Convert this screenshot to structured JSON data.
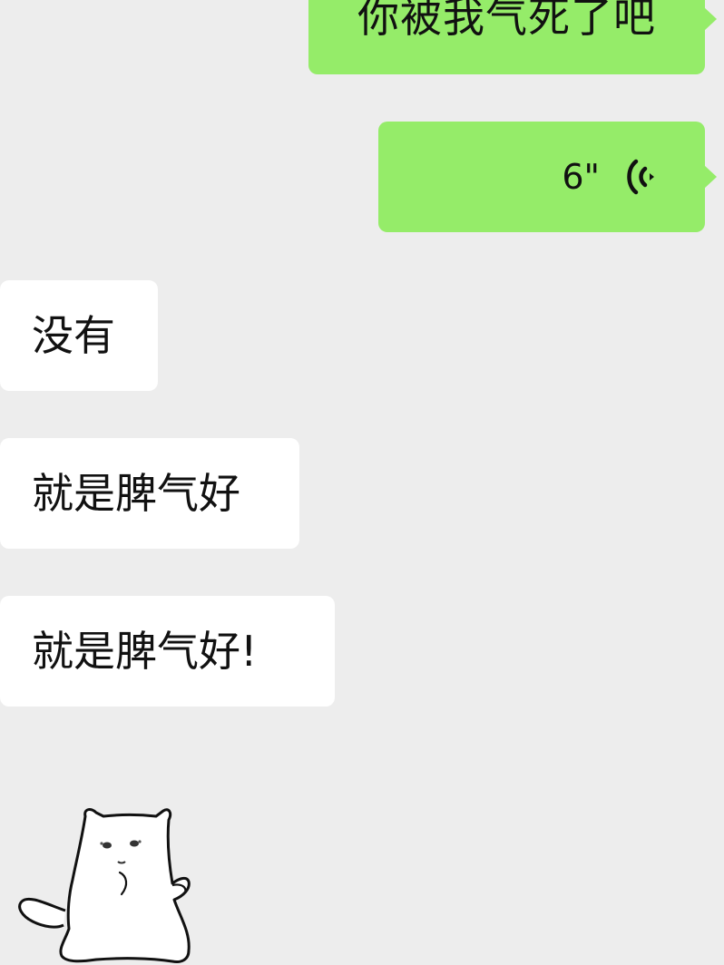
{
  "messages": {
    "sent_text": "你被我气死了吧",
    "voice_duration": "6\"",
    "recv_1": "没有",
    "recv_2": "就是脾气好",
    "recv_3": "就是脾气好!"
  },
  "icons": {
    "voice": "voice-wave-icon",
    "sticker": "cat-sticker"
  },
  "colors": {
    "background": "#ededed",
    "sent_bubble": "#95ec69",
    "recv_bubble": "#ffffff",
    "text": "#111111"
  }
}
